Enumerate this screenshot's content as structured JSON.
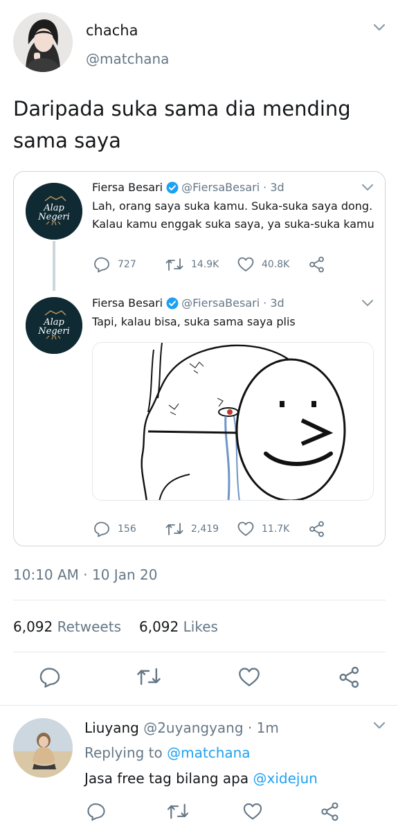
{
  "tweet": {
    "author_name": "chacha",
    "author_handle": "@matchana",
    "text": "Daripada suka sama dia mending sama saya",
    "timestamp": "10:10 AM · 10 Jan 20",
    "retweets_count": "6,092",
    "retweets_label": "Retweets",
    "likes_count": "6,092",
    "likes_label": "Likes"
  },
  "quoted_thread": [
    {
      "name": "Fiersa Besari",
      "handle": "@FiersaBesari",
      "time": "· 3d",
      "text": "Lah, orang saya suka kamu. Suka-suka saya dong. Kalau kamu enggak suka saya, ya suka-suka kamu",
      "replies": "727",
      "retweets": "14.9K",
      "likes": "40.8K"
    },
    {
      "name": "Fiersa Besari",
      "handle": "@FiersaBesari",
      "time": "· 3d",
      "text": "Tapi, kalau bisa, suka sama saya plis",
      "replies": "156",
      "retweets": "2,419",
      "likes": "11.7K"
    }
  ],
  "avatar_logo_text": {
    "line1": "Alap",
    "line2": "Negeri"
  },
  "reply": {
    "name": "Liuyang",
    "handle": "@2uyangyang",
    "time": "· 1m",
    "replying_prefix": "Replying to",
    "replying_to": "@matchana",
    "text_prefix": "Jasa free tag bilang apa",
    "mention": "@xidejun"
  },
  "icons": {
    "reply": "reply-icon",
    "retweet": "retweet-icon",
    "like": "heart-icon",
    "share": "share-icon",
    "more": "chevron-down-icon",
    "verified": "verified-badge-icon"
  },
  "colors": {
    "text": "#14171a",
    "secondary": "#657786",
    "link": "#1da1f2",
    "border": "#e1e8ed",
    "avatar_bg": "#0f2a33"
  }
}
